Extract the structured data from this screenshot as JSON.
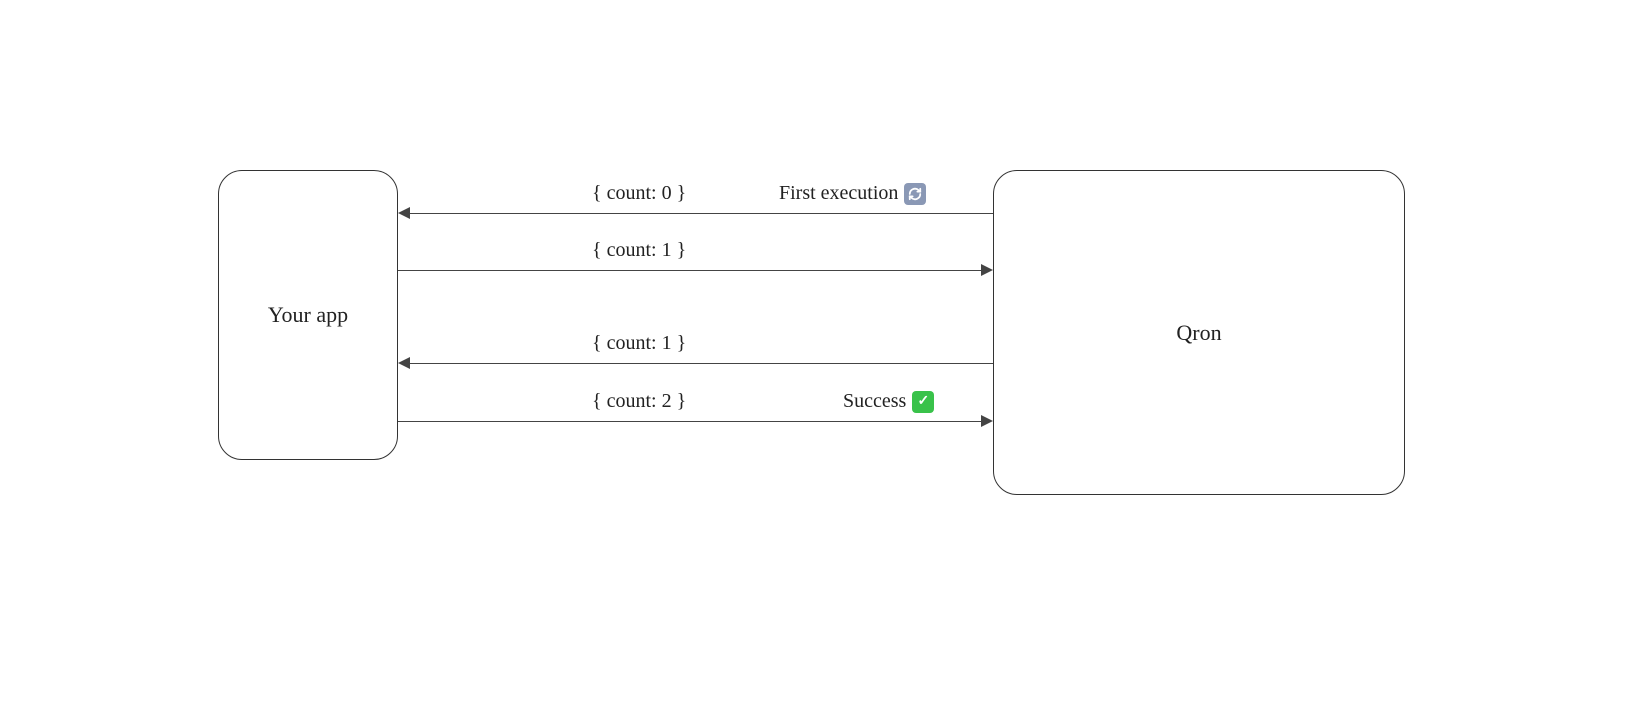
{
  "boxes": {
    "left": {
      "label": "Your app"
    },
    "right": {
      "label": "Qron"
    }
  },
  "arrows": {
    "a1": {
      "payload": "{ count: 0 }",
      "annotation": "First execution"
    },
    "a2": {
      "payload": "{ count: 1 }"
    },
    "a3": {
      "payload": "{ count: 1 }"
    },
    "a4": {
      "payload": "{ count: 2 }",
      "annotation": "Success"
    }
  }
}
